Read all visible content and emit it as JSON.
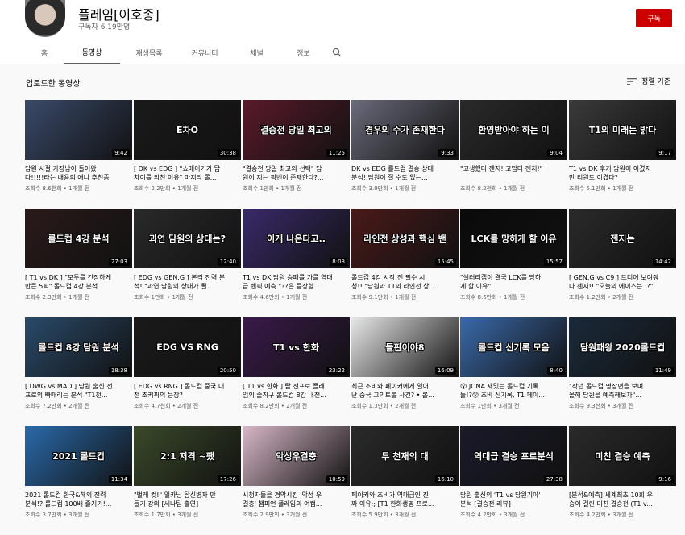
{
  "channel": {
    "name": "플레임[이호종]",
    "subscribers": "구독자 6.19만명",
    "subscribe_label": "구독",
    "accent": "#cc0000"
  },
  "tabs": [
    {
      "label": "홈",
      "active": false
    },
    {
      "label": "동영상",
      "active": true
    },
    {
      "label": "재생목록",
      "active": false
    },
    {
      "label": "커뮤니티",
      "active": false
    },
    {
      "label": "채널",
      "active": false
    },
    {
      "label": "정보",
      "active": false
    }
  ],
  "section": {
    "title": "업로드한 동영상",
    "sort_label": "정렬 기준"
  },
  "videos": [
    {
      "title1": "담원 시절 가장남이 들어왔",
      "title2": "다!!!!!라는 내용의 애니 추천좀",
      "meta": "조회수 8.6천회 • 1개월 전",
      "duration": "9:42",
      "thumb_text": "",
      "bg": "#3a4a6a"
    },
    {
      "title1": "[ DK vs EDG ] \"쇼메이커가 탑",
      "title2": "차이를 외친 이유\" 마지막 롤...",
      "meta": "조회수 2.2만회 • 1개월 전",
      "duration": "30:38",
      "thumb_text": "E차O",
      "bg": "#1a1a1a"
    },
    {
      "title1": "\"결승전 당일 최고의 선택\" 담",
      "title2": "원이 지는 픽밴이 존재한다?...",
      "meta": "조회수 1만회 • 1개월 전",
      "duration": "11:25",
      "thumb_text": "결승전 당일 최고의",
      "bg": "#5a1a2a"
    },
    {
      "title1": "DK vs EDG 롤드컵 결승 상대",
      "title2": "분석! 담원이 질 수도 있는...",
      "meta": "조회수 3.9만회 • 1개월 전",
      "duration": "9:33",
      "thumb_text": "경우의 수가 존재한다",
      "bg": "#6a6a7a"
    },
    {
      "title1": "\"고생했다 젠지! 고맙다 젠지!\"",
      "title2": "",
      "meta": "조회수 8.2천회 • 1개월 전",
      "duration": "9:04",
      "thumb_text": "환영받아야 하는 이",
      "bg": "#2a2a2a"
    },
    {
      "title1": "T1 vs DK 후기 담원이 이겼지",
      "title2": "만 티원도 이겼다?",
      "meta": "조회수 5.1만회 • 1개월 전",
      "duration": "9:17",
      "thumb_text": "T1의 미래는 밝다",
      "bg": "#3a3a3a"
    },
    {
      "title1": "[ T1 vs DK ] \"모두를 긴장하게",
      "title2": "만든 5픽\" 롤드컵 4강 분석",
      "meta": "조회수 2.3만회 • 1개월 전",
      "duration": "27:03",
      "thumb_text": "롤드컵 4강 분석",
      "bg": "#2a1a1a"
    },
    {
      "title1": "[ EDG vs GEN.G ] 본격 전력 분",
      "title2": "석! \"과연 담원의 상대가 될...",
      "meta": "조회수 1만회 • 1개월 전",
      "duration": "12:40",
      "thumb_text": "과연 담원의 상대는?",
      "bg": "#2a2a2a"
    },
    {
      "title1": "T1 vs DK 담원 승패를 가를 역대",
      "title2": "급 밴픽 예측 \"??은 등장할...",
      "meta": "조회수 4.6만회 • 1개월 전",
      "duration": "8:08",
      "thumb_text": "이게 나온다고..",
      "bg": "#3a2a6a"
    },
    {
      "title1": "롤드컵 4강 시작 전 필수 시",
      "title2": "청!! \"담원과 T1의 라인전 상...",
      "meta": "조회수 9.1만회 • 1개월 전",
      "duration": "15:45",
      "thumb_text": "라인전 상성과 핵심 밴",
      "bg": "#4a1a1a"
    },
    {
      "title1": "\"샐러리캡이 결국 LCK를 망하",
      "title2": "게 할 이유\"",
      "meta": "조회수 8.6만회 • 1개월 전",
      "duration": "15:57",
      "thumb_text": "LCK를 망하게 할 이유",
      "bg": "#0a0a0a"
    },
    {
      "title1": "[ GEN.G vs C9 ] 드디어 보여줘",
      "title2": "다 젠지!! \"오늘의 에이스는..?\"",
      "meta": "조회수 1.2만회 • 2개월 전",
      "duration": "14:42",
      "thumb_text": "젠지는",
      "bg": "#2a2a2a"
    },
    {
      "title1": "[ DWG vs MAD ] 담원 출신 전",
      "title2": "프로의 빠때리는 분석 \"T1전...",
      "meta": "조회수 7.2만회 • 2개월 전",
      "duration": "18:38",
      "thumb_text": "롤드컵 8강 담원 분석",
      "bg": "#2a4a6a"
    },
    {
      "title1": "[ EDG vs RNG ] 롤드컵 중국 내",
      "title2": "전 조커픽의 등장?",
      "meta": "조회수 4.7천회 • 2개월 전",
      "duration": "20:50",
      "thumb_text": "EDG VS RNG",
      "bg": "#1a1a1a"
    },
    {
      "title1": "[ T1 vs 한화 ] 탑 전프로 플레",
      "title2": "임의 솔직구 롤드컵 8강 내전...",
      "meta": "조회수 8.2만회 • 2개월 전",
      "duration": "23:22",
      "thumb_text": "T1 vs 한화",
      "bg": "#3a1a4a"
    },
    {
      "title1": "최근 조비와 페이커에게 일어",
      "title2": "난 중국 고의트롤 사건? • 롤...",
      "meta": "조회수 1.3만회 • 2개월 전",
      "duration": "16:09",
      "thumb_text": "들판이야8",
      "bg": "#e8e8e8"
    },
    {
      "title1": "😮 JONA 재밌는 롤드컵 기록",
      "title2": "들!?😮 조비 신기록, T1 페이...",
      "meta": "조회수 1만회 • 3개월 전",
      "duration": "8:40",
      "thumb_text": "롤드컵 신기록 모음",
      "bg": "#3a6aaa"
    },
    {
      "title1": "\"작년 롤드컵 명장면을 보며",
      "title2": "올해 담원을 예측해보자\"...",
      "meta": "조회수 9.3천회 • 3개월 전",
      "duration": "11:49",
      "thumb_text": "담원패왕 2020롤드컵",
      "bg": "#1a2a3a"
    },
    {
      "title1": "2021 롤드컵 한국&해외 전력",
      "title2": "분석!? 롤드컵 100배 즐기기!...",
      "meta": "조회수 3.7만회 • 3개월 전",
      "duration": "11:34",
      "thumb_text": "2021 롤드컵",
      "bg": "#2a6aaa"
    },
    {
      "title1": "\"벌레 컷!\" 일카님 탑신병자 만",
      "title2": "들기 강의 [세나팀 출연]",
      "meta": "조회수 1.7만회 • 3개월 전",
      "duration": "17:26",
      "thumb_text": "2:1 저격 ~팼",
      "bg": "#3a4a2a"
    },
    {
      "title1": "시청자들을 경악시킨 '악성 우",
      "title2": "결충' 챔피언 플레임의 여캠...",
      "meta": "조회수 2.9만회 • 3개월 전",
      "duration": "10:59",
      "thumb_text": "악성우결충",
      "bg": "#d8b8c8"
    },
    {
      "title1": "페이커와 조비가 역대급인 진",
      "title2": "짜 이유;; [T1 한화생명 프로...",
      "meta": "조회수 5.9만회 • 3개월 전",
      "duration": "16:10",
      "thumb_text": "두 천재의 대",
      "bg": "#2a2a2a"
    },
    {
      "title1": "담원 출신의 'T1 vs 담원기아'",
      "title2": "분석 [결승전 리뷰]",
      "meta": "조회수 4.2만회 • 3개월 전",
      "duration": "27:38",
      "thumb_text": "역대급 결승 프로분석",
      "bg": "#1a1a2a"
    },
    {
      "title1": "[분석&예측] 세계최초 10회 우",
      "title2": "승이 걸린 미친 결승전 (T1 v...",
      "meta": "조회수 4.2만회 • 3개월 전",
      "duration": "9:16",
      "thumb_text": "미친 결승 예측",
      "bg": "#2a2a2a"
    }
  ]
}
